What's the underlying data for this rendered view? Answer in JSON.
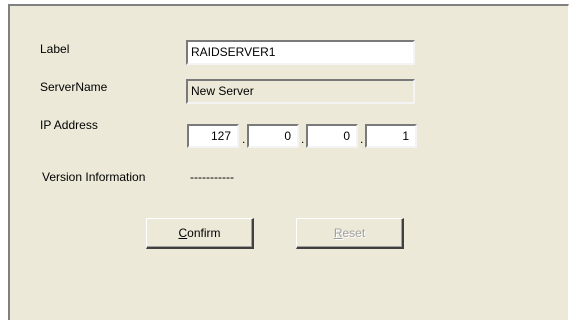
{
  "form": {
    "label": {
      "caption": "Label",
      "value": "RAIDSERVER1"
    },
    "server_name": {
      "caption": "ServerName",
      "value": "New Server"
    },
    "ip_address": {
      "caption": "IP Address",
      "octets": [
        "127",
        "0",
        "0",
        "1"
      ],
      "separator": "."
    },
    "version": {
      "caption": "Version Information",
      "value": "-----------"
    }
  },
  "buttons": {
    "confirm": {
      "mnemonic": "C",
      "rest": "onfirm",
      "enabled": true
    },
    "reset": {
      "mnemonic": "R",
      "rest": "eset",
      "enabled": false
    }
  },
  "colors": {
    "panel_bg": "#ece9d8",
    "disabled_text": "#a0a0a0"
  }
}
